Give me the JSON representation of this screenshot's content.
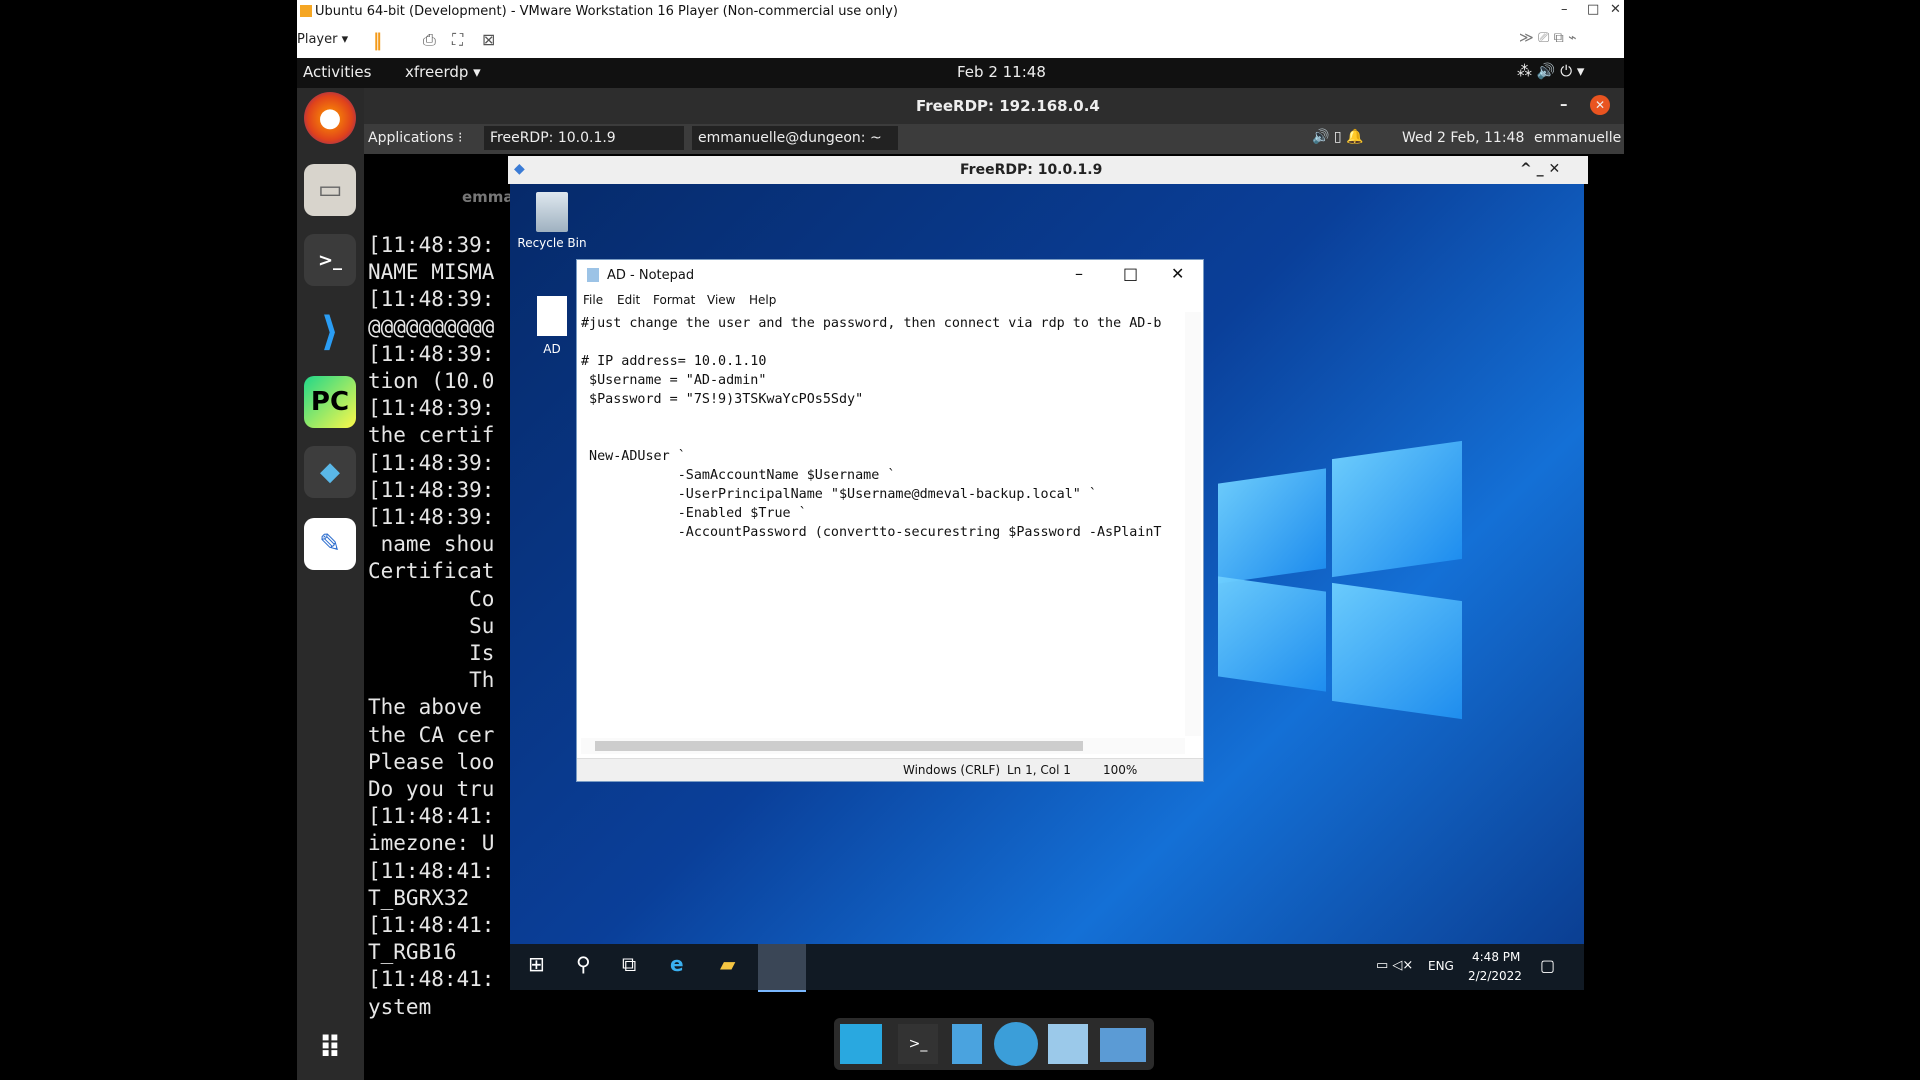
{
  "vmware": {
    "title": "Ubuntu 64-bit (Development) - VMware Workstation 16 Player (Non-commercial use only)",
    "player_menu": "Player"
  },
  "gnome": {
    "activities": "Activities",
    "app_menu": "xfreerdp",
    "clock": "Feb 2  11:48"
  },
  "freerdp_outer": {
    "title": "FreeRDP: 192.168.0.4"
  },
  "xfce_panel": {
    "applications": "Applications",
    "task1": "FreeRDP: 10.0.1.9",
    "task2": "emmanuelle@dungeon: ~",
    "clock": "Wed  2 Feb, 11:48",
    "user": "emmanuelle"
  },
  "terminal": {
    "tab_label": "emma",
    "lines": [
      "[11:48:39:",
      "NAME MISMA",
      "[11:48:39:",
      "@@@@@@@@@@",
      "[11:48:39:",
      "tion (10.0",
      "[11:48:39:",
      "the certif",
      "[11:48:39:",
      "[11:48:39:",
      "[11:48:39:",
      " name shou",
      "Certificat",
      "        Co",
      "        Su",
      "        Is",
      "        Th",
      "The above ",
      "the CA cer",
      "Please loo",
      "Do you tru",
      "[11:48:41:",
      "imezone: U",
      "[11:48:41:",
      "T_BGRX32",
      "[11:48:41:",
      "T_RGB16",
      "[11:48:41:",
      "ystem"
    ]
  },
  "freerdp_inner": {
    "title": "FreeRDP: 10.0.1.9"
  },
  "desktop": {
    "recycle_bin": "Recycle Bin",
    "file_icon": "AD"
  },
  "notepad": {
    "title": "AD - Notepad",
    "menu": [
      "File",
      "Edit",
      "Format",
      "View",
      "Help"
    ],
    "content": "#just change the user and the password, then connect via rdp to the AD-b\n\n# IP address= 10.0.1.10\n $Username = \"AD-admin\"\n $Password = \"7S!9)3TSKwaYcPOs5Sdy\"\n\n\n New-ADUser `\n            -SamAccountName $Username `\n            -UserPrincipalName \"$Username@dmeval-backup.local\" `\n            -Enabled $True `\n            -AccountPassword (convertto-securestring $Password -AsPlainT",
    "status_encoding": "Windows (CRLF)",
    "status_position": "Ln 1, Col 1",
    "status_zoom": "100%"
  },
  "windows_taskbar": {
    "lang": "ENG",
    "time": "4:48 PM",
    "date": "2/2/2022"
  }
}
